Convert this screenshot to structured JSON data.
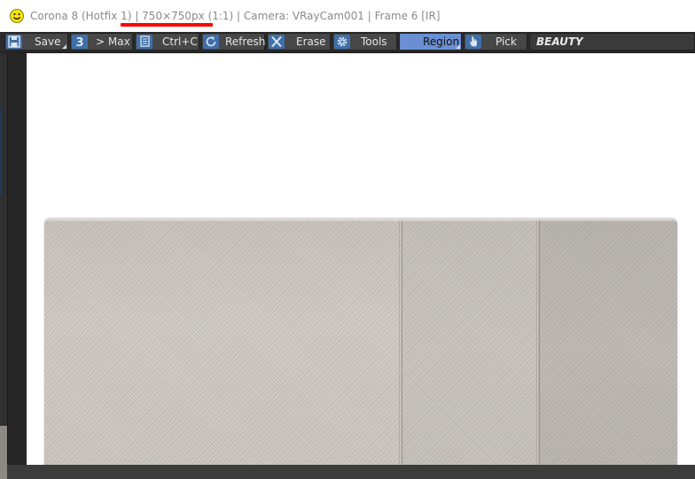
{
  "window": {
    "title": "Corona 8 (Hotfix 1) | 750×750px (1:1) | Camera: VRayCam001 | Frame 6 [IR]",
    "app_icon": "smiley-icon"
  },
  "toolbar": {
    "save_label": "Save",
    "max_label": "> Max",
    "copy_label": "Ctrl+C",
    "refresh_label": "Refresh",
    "erase_label": "Erase",
    "tools_label": "Tools",
    "region_label": "Region",
    "pick_label": "Pick",
    "render_pass": "BEAUTY"
  },
  "icons": {
    "save": "floppy-disk-icon",
    "max": "3dsmax-icon",
    "copy": "copy-icon",
    "refresh": "refresh-icon",
    "erase": "x-icon",
    "tools": "gear-icon",
    "region": "region-icon",
    "pick": "hand-pointer-icon"
  },
  "colors": {
    "accent_blue": "#3f6fa8",
    "active_button": "#6a8fd3",
    "highlight_red": "#ff0000",
    "toolbar_bg": "#2b2b2b"
  }
}
